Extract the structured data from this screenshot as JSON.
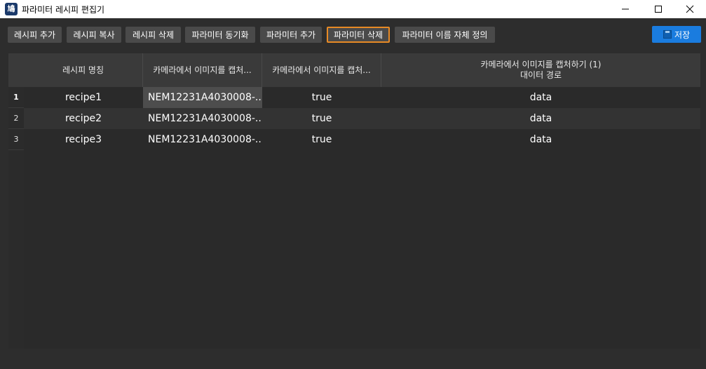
{
  "window": {
    "title": "파라미터 레시피 편집기",
    "icon_glyph": "鳩"
  },
  "toolbar": {
    "buttons": [
      {
        "label": "레시피 추가"
      },
      {
        "label": "레시피 복사"
      },
      {
        "label": "레시피 삭제"
      },
      {
        "label": "파라미터 동기화"
      },
      {
        "label": "파라미터 추가"
      },
      {
        "label": "파라미터 삭제",
        "active": true
      },
      {
        "label": "파라미터 이름 자체 정의"
      }
    ],
    "save_label": "저장"
  },
  "table": {
    "headers": [
      {
        "line1": "레시피 명칭",
        "line2": ""
      },
      {
        "line1": "카메라에서 이미지를 캡처...",
        "line2": ""
      },
      {
        "line1": "카메라에서 이미지를 캡처...",
        "line2": ""
      },
      {
        "line1": "카메라에서 이미지를 캡처하기 (1)",
        "line2": "대이터 경로"
      }
    ],
    "rows": [
      {
        "num": "1",
        "cells": [
          "recipe1",
          "NEM12231A4030008-...",
          "true",
          "data"
        ]
      },
      {
        "num": "2",
        "cells": [
          "recipe2",
          "NEM12231A4030008-...",
          "true",
          "data"
        ]
      },
      {
        "num": "3",
        "cells": [
          "recipe3",
          "NEM12231A4030008-...",
          "true",
          "data"
        ]
      }
    ]
  },
  "colors": {
    "background": "#2d2d2d",
    "button": "#4a4a4a",
    "active_border": "#e88a25",
    "save_button": "#1a7cdf"
  }
}
